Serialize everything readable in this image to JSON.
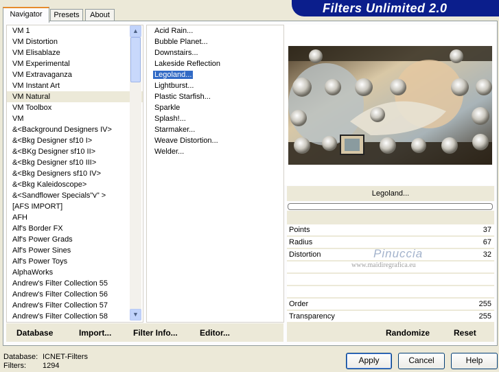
{
  "app": {
    "title": "Filters Unlimited 2.0"
  },
  "tabs": [
    {
      "label": "Navigator"
    },
    {
      "label": "Presets"
    },
    {
      "label": "About"
    }
  ],
  "categories": {
    "items": [
      "VM 1",
      "VM Distortion",
      "VM Elisablaze",
      "VM Experimental",
      "VM Extravaganza",
      "VM Instant Art",
      "VM Natural",
      "VM Toolbox",
      "VM",
      "&<Background Designers IV>",
      "&<Bkg Designer sf10 I>",
      "&<BKg Designer sf10 II>",
      "&<Bkg Designer sf10 III>",
      "&<Bkg Designers sf10 IV>",
      "&<Bkg Kaleidoscope>",
      "&<Sandflower Specials\"v\" >",
      "[AFS IMPORT]",
      "AFH",
      "Alf's Border FX",
      "Alf's Power Grads",
      "Alf's Power Sines",
      "Alf's Power Toys",
      "AlphaWorks",
      "Andrew's Filter Collection 55",
      "Andrew's Filter Collection 56",
      "Andrew's Filter Collection 57",
      "Andrew's Filter Collection 58"
    ],
    "selected": "VM Natural"
  },
  "filters": {
    "items": [
      "Acid Rain...",
      "Bubble Planet...",
      "Downstairs...",
      "Lakeside Reflection",
      "Legoland...",
      "Lightburst...",
      "Plastic Starfish...",
      "Sparkle",
      "Splash!...",
      "Starmaker...",
      "Weave Distortion...",
      "Welder..."
    ],
    "selected": "Legoland..."
  },
  "bottom_buttons": {
    "database": "Database",
    "import": "Import...",
    "filter_info": "Filter Info...",
    "editor": "Editor...",
    "randomize": "Randomize",
    "reset": "Reset"
  },
  "preview": {
    "filter_name": "Legoland..."
  },
  "params": [
    {
      "label": "Points",
      "value": "37"
    },
    {
      "label": "Radius",
      "value": "67"
    },
    {
      "label": "Distortion",
      "value": "32"
    },
    {
      "label": "Order",
      "value": "255"
    },
    {
      "label": "Transparency",
      "value": "255"
    }
  ],
  "watermark": {
    "name": "Pinuccia",
    "url": "www.maidiregrafica.eu"
  },
  "status": {
    "database_label": "Database:",
    "database_value": "ICNET-Filters",
    "filters_label": "Filters:",
    "filters_value": "1294"
  },
  "dialog_buttons": {
    "apply": "Apply",
    "cancel": "Cancel",
    "help": "Help"
  },
  "colors": {
    "banner": "#0b1e8c",
    "selection": "#316ac5",
    "face": "#ece9d8"
  }
}
